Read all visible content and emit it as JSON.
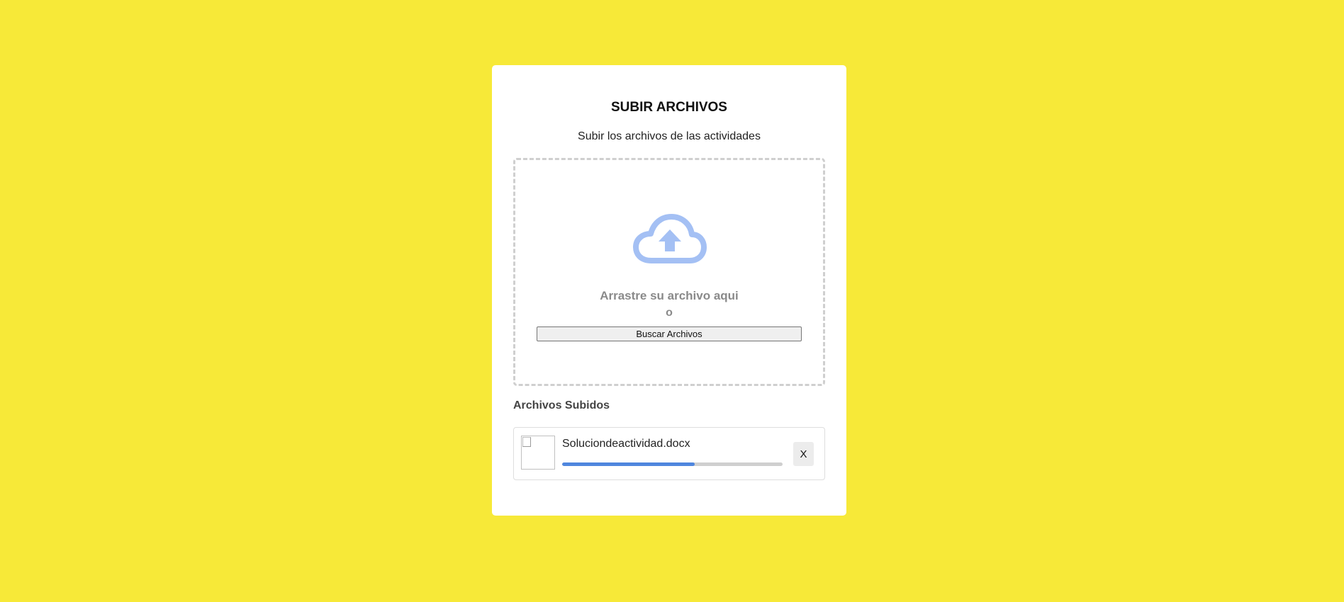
{
  "upload": {
    "title": "SUBIR ARCHIVOS",
    "subtitle": "Subir los archivos de las actividades",
    "dropzone": {
      "icon": "cloud-upload-icon",
      "icon_color": "#a4c0f4",
      "drop_text": "Arrastre su archivo aqui",
      "or_text": "o",
      "browse_label": "Buscar Archivos"
    }
  },
  "uploaded": {
    "heading": "Archivos Subidos",
    "files": [
      {
        "name": "Soluciondeactividad.docx",
        "thumbnail_icon": "broken-image-icon",
        "progress": 0.6,
        "progress_color": "#4f86de",
        "remove_label": "X"
      }
    ]
  },
  "colors": {
    "background": "#f7e938",
    "card": "#ffffff"
  }
}
